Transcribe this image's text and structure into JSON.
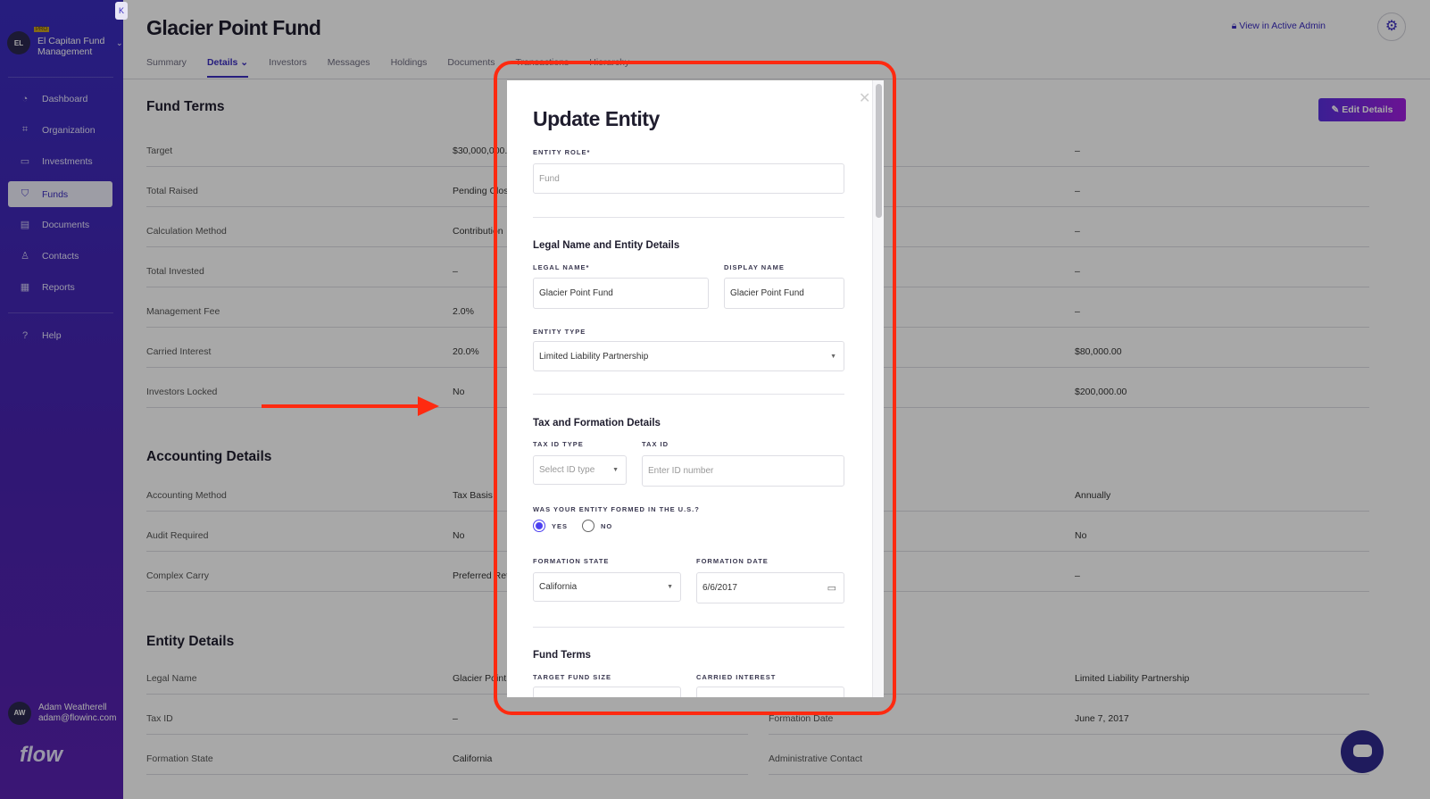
{
  "sidebar": {
    "org_initials": "EL",
    "org_badge": "PRO",
    "org_name": "El Capitan Fund Management",
    "items": [
      {
        "label": "Dashboard"
      },
      {
        "label": "Organization"
      },
      {
        "label": "Investments"
      },
      {
        "label": "Funds"
      },
      {
        "label": "Documents"
      },
      {
        "label": "Contacts"
      },
      {
        "label": "Reports"
      },
      {
        "label": "Help"
      }
    ],
    "user": {
      "initials": "AW",
      "name": "Adam Weatherell",
      "email": "adam@flowinc.com"
    },
    "logo": "flow"
  },
  "header": {
    "title": "Glacier Point Fund",
    "admin_link": "View in Active Admin",
    "edit_button": "Edit Details",
    "tabs": [
      {
        "label": "Summary"
      },
      {
        "label": "Details"
      },
      {
        "label": "Investors"
      },
      {
        "label": "Messages"
      },
      {
        "label": "Holdings"
      },
      {
        "label": "Documents"
      },
      {
        "label": "Transactions"
      },
      {
        "label": "Hierarchy"
      }
    ]
  },
  "fund_terms": {
    "title": "Fund Terms",
    "rows": [
      {
        "label": "Target",
        "value": "$30,000,000.0",
        "right_value": "–"
      },
      {
        "label": "Total Raised",
        "value": "Pending Clos",
        "right_value": "–"
      },
      {
        "label": "Calculation Method",
        "value": "Contribution",
        "right_value": "–"
      },
      {
        "label": "Total Invested",
        "value": "–",
        "right_value": "–"
      },
      {
        "label": "Management Fee",
        "value": "2.0%",
        "right_value": "–"
      },
      {
        "label": "Carried Interest",
        "value": "20.0%",
        "right_value": "$80,000.00"
      },
      {
        "label": "Investors Locked",
        "value": "No",
        "right_value": "$200,000.00"
      }
    ]
  },
  "accounting": {
    "title": "Accounting Details",
    "rows": [
      {
        "label": "Accounting Method",
        "value": "Tax Basis",
        "right_value": "Annually"
      },
      {
        "label": "Audit Required",
        "value": "No",
        "right_value": "No"
      },
      {
        "label": "Complex Carry",
        "value": "Preferred Ret",
        "right_value": "–"
      }
    ]
  },
  "entity": {
    "title": "Entity Details",
    "rows": [
      {
        "label": "Legal Name",
        "value": "Glacier Point",
        "right_label": "",
        "right_value": "Limited Liability Partnership"
      },
      {
        "label": "Tax ID",
        "value": "–",
        "right_label": "Formation Date",
        "right_value": "June 7, 2017"
      },
      {
        "label": "Formation State",
        "value": "California",
        "right_label": "Administrative Contact",
        "right_value": ""
      }
    ]
  },
  "modal": {
    "title": "Update Entity",
    "entity_role_label": "ENTITY ROLE*",
    "entity_role_placeholder": "Fund",
    "legal_section": "Legal Name and Entity Details",
    "legal_name_label": "LEGAL NAME*",
    "legal_name": "Glacier Point Fund",
    "display_name_label": "DISPLAY NAME",
    "display_name": "Glacier Point Fund",
    "entity_type_label": "ENTITY TYPE",
    "entity_type": "Limited Liability Partnership",
    "tax_section": "Tax and Formation Details",
    "tax_id_type_label": "TAX ID TYPE",
    "tax_id_type_placeholder": "Select ID type",
    "tax_id_label": "TAX ID",
    "tax_id_placeholder": "Enter ID number",
    "formed_us_label": "WAS YOUR ENTITY FORMED IN THE U.S.?",
    "yes": "YES",
    "no": "NO",
    "formed_us_value": "YES",
    "formation_state_label": "FORMATION STATE",
    "formation_state": "California",
    "formation_date_label": "FORMATION DATE",
    "formation_date": "6/6/2017",
    "fund_terms_section": "Fund Terms",
    "target_fund_size_label": "TARGET FUND SIZE",
    "carried_interest_label": "CARRIED INTEREST"
  },
  "colors": {
    "accent": "#3a2cc0",
    "annotation": "#ff2a10"
  }
}
